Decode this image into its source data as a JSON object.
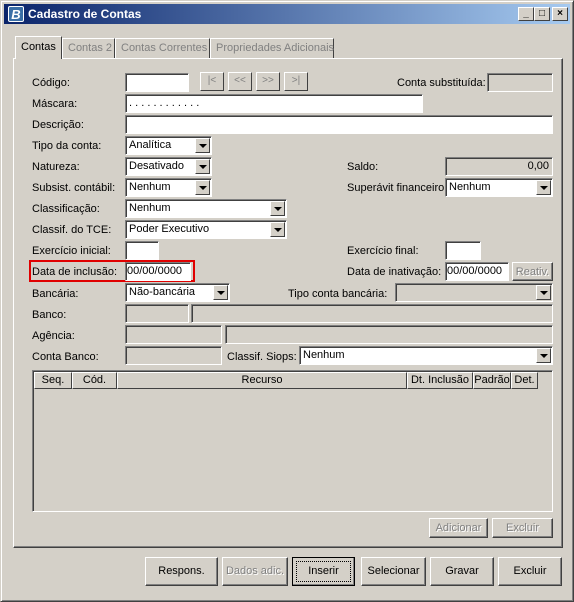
{
  "window": {
    "title": "Cadastro de Contas",
    "icon_letter": "B",
    "controls": [
      "minimize-icon",
      "maximize-icon",
      "close-icon"
    ]
  },
  "tabs": [
    {
      "label": "Contas",
      "active": true
    },
    {
      "label": "Contas 2",
      "active": false
    },
    {
      "label": "Contas Correntes",
      "active": false
    },
    {
      "label": "Propriedades Adicionais",
      "active": false
    }
  ],
  "nav": {
    "first": "|<",
    "prev": "<<",
    "next": ">>",
    "last": ">|"
  },
  "form": {
    "codigo": {
      "label": "Código:",
      "value": ""
    },
    "conta_substituida": {
      "label": "Conta substituída:",
      "value": ""
    },
    "mascara": {
      "label": "Máscara:",
      "value": ". . . . . . . . . . . ."
    },
    "descricao": {
      "label": "Descrição:",
      "value": ""
    },
    "tipo_conta": {
      "label": "Tipo da conta:",
      "value": "Analítica"
    },
    "natureza": {
      "label": "Natureza:",
      "value": "Desativado"
    },
    "saldo": {
      "label": "Saldo:",
      "value": "0,00"
    },
    "subsist_contabil": {
      "label": "Subsist. contábil:",
      "value": "Nenhum"
    },
    "superavit_financeiro": {
      "label": "Superávit financeiro:",
      "value": "Nenhum"
    },
    "classificacao": {
      "label": "Classificação:",
      "value": "Nenhum"
    },
    "classif_tce": {
      "label": "Classif. do TCE:",
      "value": "Poder Executivo"
    },
    "exercicio_inicial": {
      "label": "Exercício inicial:",
      "value": ""
    },
    "exercicio_final": {
      "label": "Exercício final:",
      "value": ""
    },
    "data_inclusao": {
      "label": "Data de inclusão:",
      "value": "00/00/0000"
    },
    "data_inativacao": {
      "label": "Data de inativação:",
      "value": "00/00/0000"
    },
    "reativ_label": "Reativ.",
    "bancaria": {
      "label": "Bancária:",
      "value": "Não-bancária"
    },
    "tipo_conta_bancaria": {
      "label": "Tipo conta bancária:",
      "value": ""
    },
    "banco": {
      "label": "Banco:",
      "code": "",
      "name": ""
    },
    "agencia": {
      "label": "Agência:",
      "code": "",
      "name": ""
    },
    "conta_banco": {
      "label": "Conta Banco:",
      "value": ""
    },
    "classif_siops": {
      "label": "Classif. Siops:",
      "value": "Nenhum"
    }
  },
  "grid": {
    "columns": [
      "Seq.",
      "Cód.",
      "Recurso",
      "Dt. Inclusão",
      "Padrão",
      "Det."
    ],
    "rows": []
  },
  "grid_buttons": {
    "adicionar": "Adicionar",
    "excluir": "Excluir"
  },
  "footer": {
    "respons": "Respons.",
    "dados_adic": "Dados adic.",
    "inserir": "Inserir",
    "selecionar": "Selecionar",
    "gravar": "Gravar",
    "excluir": "Excluir"
  },
  "colors": {
    "titlebar_start": "#0a246a",
    "titlebar_end": "#a6caf0",
    "highlight": "#e00000",
    "face": "#d4d0c8"
  }
}
